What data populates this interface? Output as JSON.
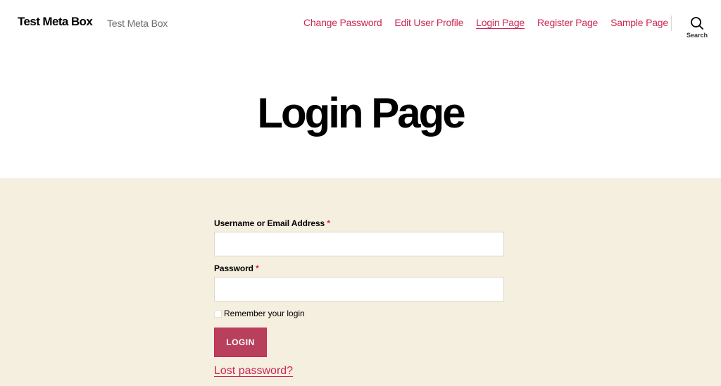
{
  "header": {
    "site_title": "Test Meta Box",
    "site_description": "Test Meta Box",
    "nav": [
      {
        "label": "Change Password",
        "current": false
      },
      {
        "label": "Edit User Profile",
        "current": false
      },
      {
        "label": "Login Page",
        "current": true
      },
      {
        "label": "Register Page",
        "current": false
      },
      {
        "label": "Sample Page",
        "current": false
      }
    ],
    "search_label": "Search"
  },
  "page": {
    "title": "Login Page"
  },
  "form": {
    "username_label": "Username or Email Address",
    "username_value": "",
    "password_label": "Password",
    "password_value": "",
    "required_marker": "*",
    "remember_label": "Remember your login",
    "remember_checked": false,
    "login_button": "LOGIN",
    "lost_password_link": "Lost password?"
  },
  "colors": {
    "accent": "#cd2653",
    "button_bg": "#b8405c",
    "content_bg": "#f5efe0"
  }
}
